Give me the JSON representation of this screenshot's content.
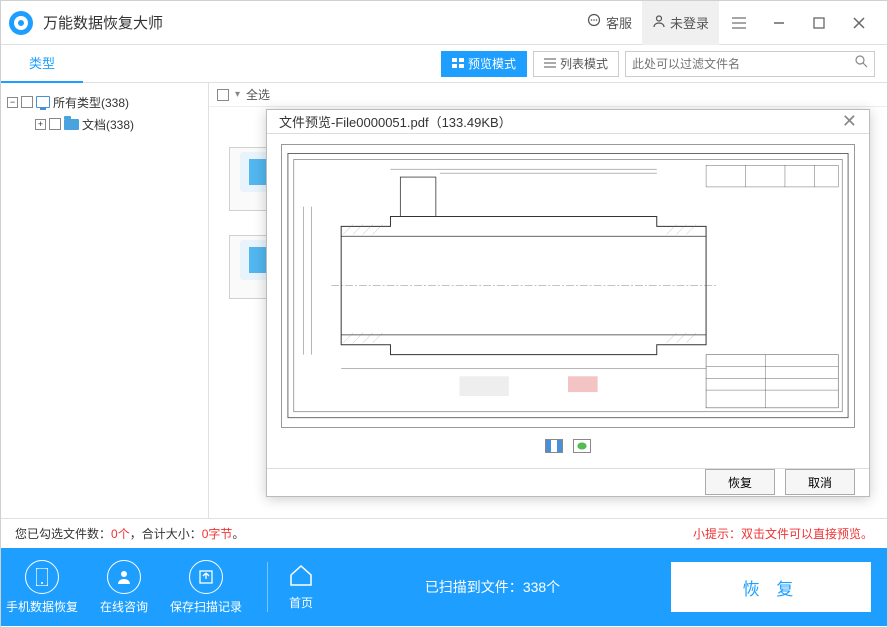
{
  "titlebar": {
    "app_title": "万能数据恢复大师",
    "service_label": "客服",
    "login_label": "未登录"
  },
  "toolbar": {
    "tab_type": "类型",
    "preview_mode": "预览模式",
    "list_mode": "列表模式",
    "search_placeholder": "此处可以过滤文件名"
  },
  "tree": {
    "all_types": "所有类型(338)",
    "docs": "文档(338)"
  },
  "content": {
    "select_all": "全选"
  },
  "statusbar": {
    "selected_prefix": "您已勾选文件数：",
    "selected_count": "0个",
    "total_prefix": "，合计大小：",
    "total_size": "0字节",
    "period": "。",
    "tip": "小提示：双击文件可以直接预览。"
  },
  "bottombar": {
    "mobile_recover": "手机数据恢复",
    "online_consult": "在线咨询",
    "save_scan": "保存扫描记录",
    "home": "首页",
    "scan_prefix": "已扫描到文件：",
    "scan_count": "338个",
    "recover_btn": "恢 复"
  },
  "modal": {
    "title": "文件预览-File0000051.pdf（133.49KB）",
    "recover_btn": "恢复",
    "cancel_btn": "取消"
  }
}
